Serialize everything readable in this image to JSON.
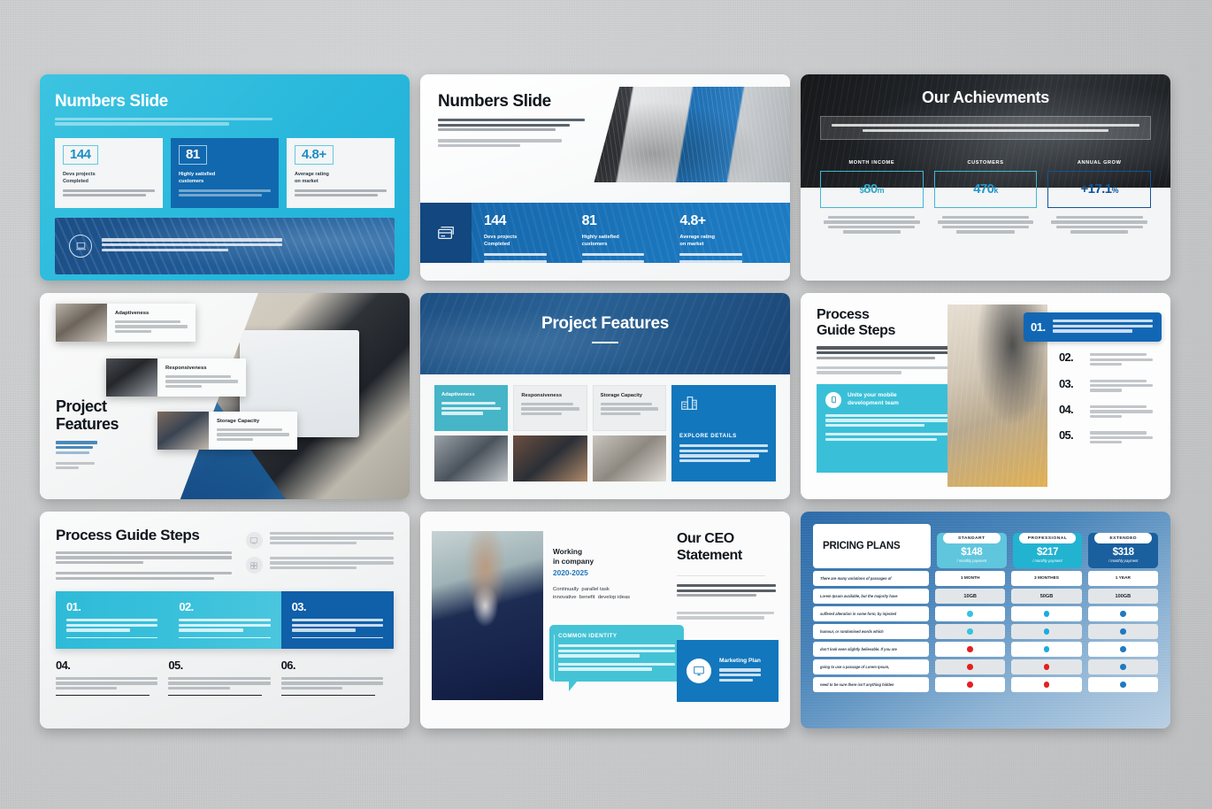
{
  "background_color": "#cacbcc",
  "slides": [
    {
      "id": "numbers-slide-cyan",
      "title": "Numbers Slide",
      "subtitle": "There are many variations of passages of Lorem Ipsum available, but the majority have suffered alteration in some form, by injected humour.",
      "stats": [
        {
          "value": "144",
          "title": "Devs projects\nCompleted",
          "body": "There are many variations of passages of Lorem Ipsum available, but the majority."
        },
        {
          "value": "81",
          "title": "Highly satisfied\ncustomers",
          "body": "There are many variations of passages of Lorem Ipsum available, but the majority."
        },
        {
          "value": "4.8+",
          "title": "Average rating\non market",
          "body": "There are many variations of passages of Lorem Ipsum available, but the majority."
        }
      ],
      "banner_text": "There are many variations of passages of Lorem Ipsum available, but the majority have suffered alteration in some form, by injected humour, or randomised.",
      "banner_icon": "laptop-icon",
      "accent": "#29b8dc"
    },
    {
      "id": "numbers-slide-white",
      "title": "Numbers Slide",
      "paragraph_1": "There are many variations of passages of Lorem Ipsum available, but the majority have suffered alteration in some form, by injected humour, or randomised words",
      "paragraph_2": "which don't look even slightly believable. If you are going to use a passage of Lorem Ipsum.",
      "strip_icon": "credit-card-icon",
      "stats": [
        {
          "value": "144",
          "title": "Devs projects\nCompleted",
          "body": "There are many variations of passages of Lorem Ipsum available."
        },
        {
          "value": "81",
          "title": "Highly satisfied\ncustomers",
          "body": "There are many variations of passages of Lorem Ipsum available."
        },
        {
          "value": "4.8+",
          "title": "Average rating\non market",
          "body": "There are many variations of passages of Lorem Ipsum available."
        }
      ],
      "accent": "#1a74ba"
    },
    {
      "id": "our-achievments",
      "title": "Our Achievments",
      "intro": "There are many variations of passages of Lorem Ipsum available, but the majority have suffered alteration in some form, by injected humour, or randomised words which don't look even slightly believable. If you are going to use a passage of Lorem Ipsum, you need to be sure there.",
      "cards": [
        {
          "label": "MONTH INCOME",
          "value": "$80",
          "unit": "m",
          "body": "There are many variations of passages of Lorem Ipsum available, but the majority have suffered alteration in some form, by injected humour, or randomised."
        },
        {
          "label": "CUSTOMERS",
          "value": "470",
          "unit": "k",
          "body": "There are many variations of passages of Lorem Ipsum available, but the majority have suffered alteration in some form, by injected humour, or randomised."
        },
        {
          "label": "ANNUAL GROW",
          "value": "+17.1",
          "unit": "%",
          "body": "There are many variations of passages of Lorem Ipsum available, but the majority have suffered alteration in some form, by injected humour, or randomised."
        }
      ],
      "accent": "#35a9c9"
    },
    {
      "id": "project-features-photos",
      "title": "Project\nFeatures",
      "paragraph_1": "There are many variations of passages of Lorem Ipsum available, but the majority have suffered alteration in some form, by injected humour, or randomised words",
      "paragraph_2": "which don't look even slightly believable. If you are going to use a passage of Lorem Ipsum.",
      "features": [
        {
          "title": "Adaptiveness",
          "body": "There are many variations of passages of Lorem Ipsum available, but the majority."
        },
        {
          "title": "Responsiveness",
          "body": "There are many variations of passages of Lorem Ipsum available, but the majority."
        },
        {
          "title": "Storage Capacity",
          "body": "There are many variations of passages of Lorem Ipsum available, but the majority."
        }
      ],
      "accent": "#1a6aa8"
    },
    {
      "id": "project-features-cards",
      "title": "Project Features",
      "cards": [
        {
          "title": "Adaptiveness",
          "body": "There are many variations Of passages of Lorem Ipsum available majority."
        },
        {
          "title": "Responsiveness",
          "body": "There are many variations Of passages of Lorem Ipsum available majority."
        },
        {
          "title": "Storage Capacity",
          "body": "There are many variations Of passages of Lorem Ipsum available majority."
        }
      ],
      "explore": {
        "icon": "buildings-icon",
        "title": "EXPLORE DETAILS",
        "body": "There are many variations of passages of Lorem Ipsum available, but the majority have suffered alteration in some form, by injected humour, or randomised words."
      },
      "accent": "#1277bd"
    },
    {
      "id": "process-guide-steps-image",
      "title": "Process\nGuide Steps",
      "paragraph_1": "There are many variations of passages of Lorem Ipsum available, but the majority have suffered alteration in some form, by injected humour, or randomised words",
      "paragraph_2": "which don't look even slightly believable. If you are going to use a passage of Lorem Ipsum.",
      "unite": {
        "icon": "mobile-icon",
        "title": "Unite your mobile\ndevelopment team",
        "body_1": "There are many variations of passages of Lorem Ipsum available, but the majority have suffered alteration in some form, by injected humour,",
        "body_2": "or randomised words which don't look even slightly believable. If you are going to use a passage."
      },
      "steps": [
        {
          "num": "01.",
          "body": "There are many variations of passages of Lorem Ipsum available, but the majority have suffered alteration in some form"
        },
        {
          "num": "02.",
          "body": "There are many variations of passages of Lorem Ipsum available."
        },
        {
          "num": "03.",
          "body": "There are many variations of passages of Lorem Ipsum available."
        },
        {
          "num": "04.",
          "body": "There are many variations of passages of Lorem Ipsum available."
        },
        {
          "num": "05.",
          "body": "There are many variations of passages of Lorem Ipsum available."
        }
      ],
      "accent": "#1267b5"
    },
    {
      "id": "process-guide-steps-grid",
      "title": "Process Guide Steps",
      "paragraph_1": "There are many variations of passages of Lorem Ipsum available, but the majority have suffered alteration in some form, by injected humour, or randomised words which don't look even slightly believable.",
      "paragraph_2": "If you are going to use a passage of Lorem Ipsum, you need to be sure there isn't anything embarrassing hidden in the middle of text. All the Lorem Ipsum.",
      "icon_rows": [
        {
          "icon": "presentation-icon",
          "body": "There are many variations of passages of Lorem Ipsum available, but the majority have suffered alteration in some form, by injected humour, or randomised."
        },
        {
          "icon": "grid-icon",
          "body": "There are many variations of passages of Lorem Ipsum available, but the majority have suffered alteration in some form, by injected humour, or randomised."
        }
      ],
      "steps": [
        {
          "num": "01.",
          "body": "There are many variations of passages of Lorem Ipsum available, but the majority have suffered alteration."
        },
        {
          "num": "02.",
          "body": "There are many variations of passages of Lorem Ipsum available, but the majority have suffered alteration."
        },
        {
          "num": "03.",
          "body": "There are many variations of passages of Lorem Ipsum available, but the majority have suffered alteration."
        },
        {
          "num": "04.",
          "body": "There are many variations of passages of Lorem Ipsum available, but the majority have suffered alteration."
        },
        {
          "num": "05.",
          "body": "There are many variations of passages of Lorem Ipsum available, but the majority have suffered alteration."
        },
        {
          "num": "06.",
          "body": "There are many variations of passages of Lorem Ipsum available, but the majority have suffered alteration."
        }
      ],
      "accent": "#38c0db"
    },
    {
      "id": "our-ceo-statement",
      "title": "Our CEO\nStatement",
      "working_label": "Working\nin company",
      "working_years": "2020-2025",
      "working_sub": "Continually  parallel task\ninnovative  benefit  develop ideas",
      "paragraph_1": "There are many variations of passages of Lorem Ipsum available, but the majority have suffered alteration in some form,",
      "paragraph_2": "by injected humour, or randomised words which don't look even slightly believable.",
      "bubble": {
        "title": "COMMON IDENTITY",
        "body_1": "There are many variations of passages of Lorem Ipsum available, but the majority have suffered alteration in some form, by injected humour,",
        "body_2": "or randomised words which don't look even slightly believable. If you are going to use a passage."
      },
      "marketing": {
        "icon": "monitor-icon",
        "title": "Marketing Plan",
        "body": "There are many variations of passages of Lorem Ipsum available, but the majority have suffered alteration in some."
      },
      "accent": "#44c3d6"
    },
    {
      "id": "pricing-plans",
      "title": "PRICING PLANS",
      "plans": [
        {
          "name": "STANDART",
          "price": "$148",
          "meta": "/ monthly payment",
          "color": "#5fc6dd"
        },
        {
          "name": "PROFESSIONAL",
          "price": "$217",
          "meta": "/ monthly payment",
          "color": "#22b3d1"
        },
        {
          "name": "EXTENDED",
          "price": "$318",
          "meta": "/ monthly payment",
          "color": "#1a5f9e"
        }
      ],
      "rows": [
        {
          "label": "There are many variations of passages of",
          "cells": [
            "1 MONTH",
            "3 MONTHES",
            "1 YEAR"
          ],
          "type": "text"
        },
        {
          "label": "Lorem Ipsum available, but the majority have",
          "cells": [
            "10GB",
            "50GB",
            "100GB"
          ],
          "type": "text"
        },
        {
          "label": "suffered alteration in some form, by injected",
          "cells": [
            "yes",
            "yes",
            "yes"
          ],
          "type": "dot"
        },
        {
          "label": "humour, or randomised words which",
          "cells": [
            "yes",
            "yes",
            "yes"
          ],
          "type": "dot"
        },
        {
          "label": "don't look even slightly believable. If you are",
          "cells": [
            "no",
            "yes",
            "yes"
          ],
          "type": "dot"
        },
        {
          "label": "going to use a passage of Lorem Ipsum,",
          "cells": [
            "no",
            "no",
            "yes"
          ],
          "type": "dot"
        },
        {
          "label": "need to be sure there isn't anything hidden",
          "cells": [
            "no",
            "no",
            "yes"
          ],
          "type": "dot"
        }
      ],
      "accent": "#1a5f9e"
    }
  ]
}
